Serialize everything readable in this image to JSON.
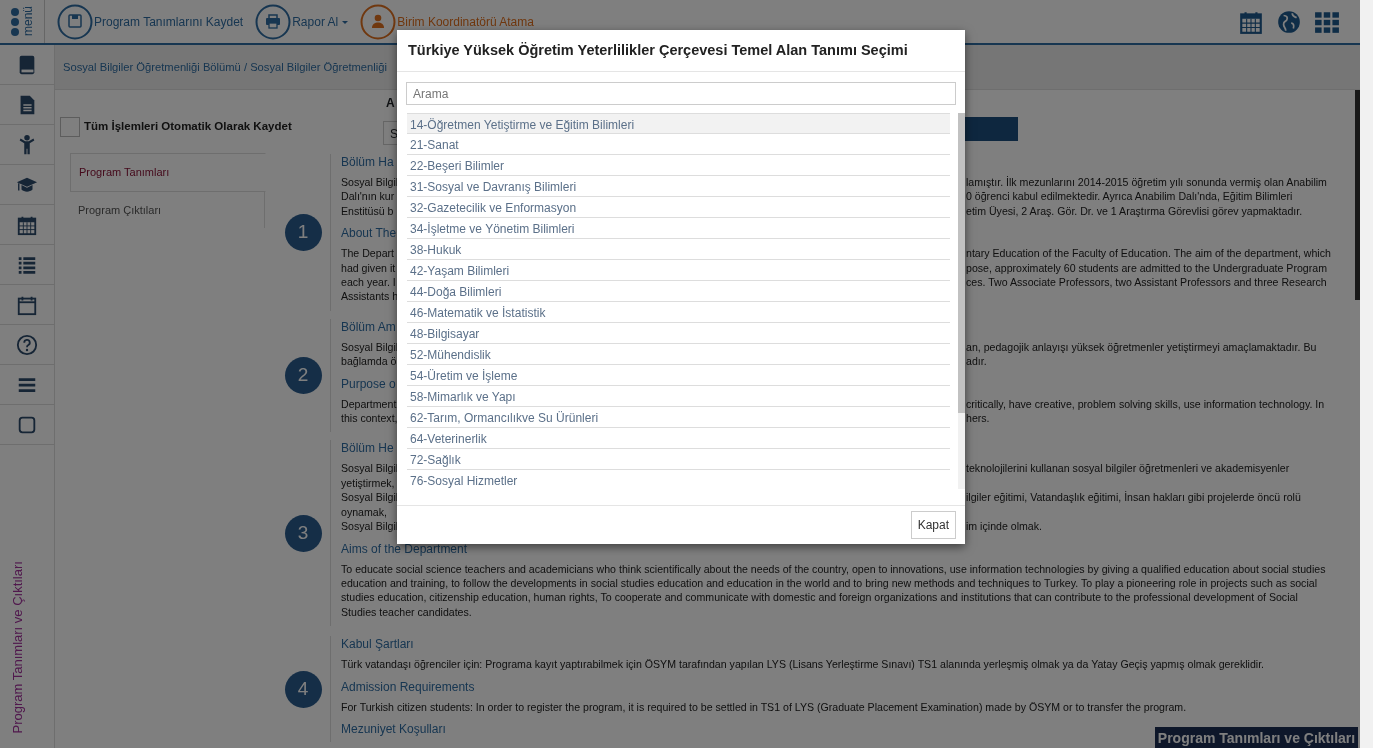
{
  "topbar": {
    "logo": "menü",
    "actions": [
      {
        "kind": "save",
        "label": "Program Tanımlarını Kaydet",
        "dropdown": false
      },
      {
        "kind": "print",
        "label": "Rapor Al",
        "dropdown": true
      },
      {
        "kind": "user",
        "label": "Birim Koordinatörü Atama",
        "dropdown": false
      }
    ],
    "icons": [
      {
        "kind": "calendar"
      },
      {
        "kind": "globe"
      },
      {
        "kind": "grid"
      }
    ]
  },
  "sidebar": {
    "icons": [
      {
        "kind": "book"
      },
      {
        "kind": "document"
      },
      {
        "kind": "child"
      },
      {
        "kind": "graduation"
      },
      {
        "kind": "calendar"
      },
      {
        "kind": "list"
      },
      {
        "kind": "calendar-empty"
      },
      {
        "kind": "question"
      },
      {
        "kind": "menu"
      },
      {
        "kind": "square"
      }
    ],
    "vertical_label": "Program Tanımları ve Çıktıları"
  },
  "breadcrumb": "Sosyal Bilgiler Öğretmenliği Bölümü / Sosyal Bilgiler Öğretmenliği",
  "autosave": {
    "label": "Tüm İşlemleri Otomatik Olarak Kaydet",
    "checked": false
  },
  "tabs": [
    {
      "label": "Program Tanımları",
      "selected": true
    },
    {
      "label": "Program Çıktıları",
      "selected": false
    }
  ],
  "filter": {
    "label": "A",
    "select_value": "S"
  },
  "sections": [
    {
      "number": "1",
      "blocks": [
        {
          "kind": "heading",
          "lines": [
            {
              "left": "Bölüm Ha"
            }
          ]
        },
        {
          "kind": "paragraph",
          "lines": [
            {
              "left": "Sosyal Bilgil",
              "right": "lamıştır. İlk mezunlarını 2014-2015 öğretim yılı sonunda vermiş olan Anabilim"
            },
            {
              "left": "Dalı'nın kur",
              "right": "0 öğrenci kabul edilmektedir. Ayrıca Anabilim Dalı'nda, Eğitim Bilimleri"
            },
            {
              "left": "Enstitüsü b",
              "right": "etim Üyesi, 2 Araş. Gör. Dr. ve 1 Araştırma Görevlisi görev yapmaktadır."
            }
          ]
        },
        {
          "kind": "heading",
          "lines": [
            {
              "left": "About The"
            }
          ]
        },
        {
          "kind": "paragraph",
          "lines": [
            {
              "left": "The Depart",
              "right": "ntary Education of the Faculty of Education. The aim of the department, which"
            },
            {
              "left": "had given it",
              "right": "pose, approximately 60 students are admitted to the Undergraduate Program"
            },
            {
              "left": "each year. I",
              "right": "ces. Two Associate Professors, two Assistant Professors and three Research"
            },
            {
              "left": "Assistants h"
            }
          ]
        }
      ]
    },
    {
      "number": "2",
      "blocks": [
        {
          "kind": "heading",
          "lines": [
            {
              "left": "Bölüm Am"
            }
          ]
        },
        {
          "kind": "paragraph",
          "lines": [
            {
              "left": "Sosyal Bilgil",
              "right": "an, pedagojik anlayışı yüksek öğretmenler yetiştirmeyi amaçlamaktadır. Bu"
            },
            {
              "left": "bağlamda ö",
              "right": "adır."
            }
          ]
        },
        {
          "kind": "heading",
          "lines": [
            {
              "left": "Purpose o"
            }
          ]
        },
        {
          "kind": "paragraph",
          "lines": [
            {
              "left": "Department",
              "right": "critically, have creative, problem solving skills, use information technology. In"
            },
            {
              "left": "this context,",
              "right": "hers."
            }
          ]
        }
      ]
    },
    {
      "number": "3",
      "blocks": [
        {
          "kind": "heading",
          "lines": [
            {
              "left": "Bölüm He"
            }
          ]
        },
        {
          "kind": "paragraph",
          "lines": [
            {
              "left": "Sosyal Bilgil",
              "right": "teknolojilerini kullanan sosyal bilgiler öğretmenleri ve akademisyenler"
            },
            {
              "left": "yetiştirmek,"
            },
            {
              "left": "Sosyal Bilgil",
              "right": "ilgiler eğitimi, Vatandaşlık eğitimi, İnsan hakları gibi projelerde öncü rolü"
            },
            {
              "left": "oynamak,"
            },
            {
              "left": "Sosyal Bilgil",
              "right": "im içinde olmak."
            }
          ]
        },
        {
          "kind": "heading",
          "text": "Aims of the Department"
        },
        {
          "kind": "paragraph",
          "text": "To educate social science teachers and academicians who think scientifically about the needs of the country, open to innovations, use information technologies by giving a qualified education about social studies education and training, to follow the developments in social studies education and education in the world and to bring new methods and techniques to Turkey. To play a pioneering role in projects such as social studies education, citizenship education, human rights, To cooperate and communicate with domestic and foreign organizations and institutions that can contribute to the professional development of Social Studies teacher candidates."
        }
      ]
    },
    {
      "number": "4",
      "blocks": [
        {
          "kind": "heading",
          "text": "Kabul Şartları"
        },
        {
          "kind": "paragraph",
          "text": "Türk vatandaşı öğrenciler için: Programa kayıt yaptırabilmek için ÖSYM tarafından yapılan LYS (Lisans Yerleştirme Sınavı) TS1 alanında yerleşmiş olmak ya da Yatay Geçiş yapmış olmak gereklidir."
        },
        {
          "kind": "heading",
          "text": "Admission Requirements"
        },
        {
          "kind": "paragraph",
          "text": "For Turkish citizen students: In order to register the program, it is required to be settled in TS1 of LYS (Graduate Placement Examination) made by ÖSYM or to transfer the program."
        },
        {
          "kind": "heading",
          "text": "Mezuniyet Koşulları"
        }
      ]
    }
  ],
  "bottom_tab": "Program Tanımları ve Çıktıları",
  "modal": {
    "title": "Türkiye Yüksek Öğretim Yeterlilikler Çerçevesi Temel Alan Tanımı Seçimi",
    "search": {
      "placeholder": "Arama"
    },
    "items": [
      {
        "label": "14-Öğretmen Yetiştirme ve Eğitim Bilimleri",
        "selected": true
      },
      {
        "label": "21-Sanat",
        "selected": false
      },
      {
        "label": "22-Beşeri Bilimler",
        "selected": false
      },
      {
        "label": "31-Sosyal ve Davranış Bilimleri",
        "selected": false
      },
      {
        "label": "32-Gazetecilik ve Enformasyon",
        "selected": false
      },
      {
        "label": "34-İşletme ve Yönetim Bilimleri",
        "selected": false
      },
      {
        "label": "38-Hukuk",
        "selected": false
      },
      {
        "label": "42-Yaşam Bilimleri",
        "selected": false
      },
      {
        "label": "44-Doğa Bilimleri",
        "selected": false
      },
      {
        "label": "46-Matematik ve İstatistik",
        "selected": false
      },
      {
        "label": "48-Bilgisayar",
        "selected": false
      },
      {
        "label": "52-Mühendislik",
        "selected": false
      },
      {
        "label": "54-Üretim ve İşleme",
        "selected": false
      },
      {
        "label": "58-Mimarlık ve Yapı",
        "selected": false
      },
      {
        "label": "62-Tarım, Ormancılıkve Su Ürünleri",
        "selected": false
      },
      {
        "label": "64-Veterinerlik",
        "selected": false
      },
      {
        "label": "72-Sağlık",
        "selected": false
      },
      {
        "label": "76-Sosyal Hizmetler",
        "selected": false
      }
    ],
    "close_button": "Kapat"
  }
}
